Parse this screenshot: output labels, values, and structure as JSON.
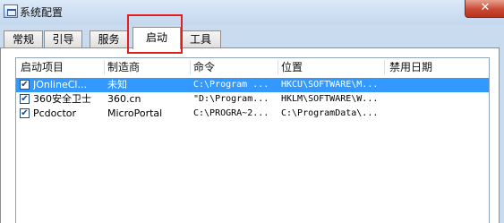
{
  "window": {
    "title": "系统配置",
    "close_symbol": "✕"
  },
  "tabs": [
    {
      "label": "常规"
    },
    {
      "label": "引导"
    },
    {
      "label": "服务"
    },
    {
      "label": "启动",
      "active": true
    },
    {
      "label": "工具"
    }
  ],
  "startup_list": {
    "columns": [
      "启动项目",
      "制造商",
      "命令",
      "位置",
      "禁用日期"
    ],
    "check_symbol": "✔",
    "rows": [
      {
        "checked": true,
        "selected": true,
        "item": "JOnlineCl...",
        "manufacturer": "未知",
        "command": "C:\\Program ...",
        "location": "HKCU\\SOFTWARE\\M...",
        "disabled_date": ""
      },
      {
        "checked": true,
        "selected": false,
        "item": "360安全卫士",
        "manufacturer": "360.cn",
        "command": "\"D:\\Program...",
        "location": "HKLM\\SOFTWARE\\W...",
        "disabled_date": ""
      },
      {
        "checked": true,
        "selected": false,
        "item": "Pcdoctor",
        "manufacturer": "MicroPortal",
        "command": "C:\\PROGRA~2...",
        "location": "C:\\ProgramData\\...",
        "disabled_date": ""
      }
    ]
  },
  "colors": {
    "selection": "#3399ff",
    "highlight_box": "#e0201e",
    "close_button": "#c94a33"
  }
}
